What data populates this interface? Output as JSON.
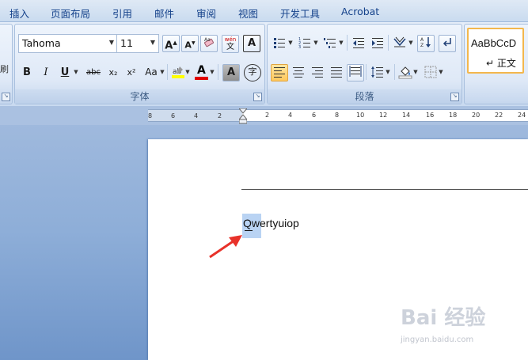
{
  "tabs": [
    "插入",
    "页面布局",
    "引用",
    "邮件",
    "审阅",
    "视图",
    "开发工具",
    "Acrobat"
  ],
  "left_edge_glyph": "刷",
  "font_group": {
    "label": "字体",
    "font_name": "Tahoma",
    "font_size": "11",
    "grow_label": "A",
    "shrink_label": "A",
    "bold": "B",
    "italic": "I",
    "underline": "U",
    "strikethrough": "abc",
    "subscript": "x₂",
    "superscript": "x²",
    "change_case": "Aa",
    "font_color_letter": "A",
    "shading_letter": "A",
    "phonetic_label": "wén",
    "enclose_char": "字",
    "highlight_color": "#ffff00",
    "font_color": "#e00000"
  },
  "paragraph_group": {
    "label": "段落"
  },
  "styles": {
    "preview": "AaBbCcD",
    "name": "↵ 正文"
  },
  "ruler": {
    "labels": [
      "8",
      "6",
      "4",
      "2",
      "2",
      "4",
      "6",
      "8",
      "10",
      "12",
      "14",
      "16",
      "18",
      "20",
      "22",
      "24"
    ]
  },
  "document": {
    "text": "Qwertyuiop"
  },
  "watermark": {
    "main": "Bai 经验",
    "sub": "jingyan.baidu.com"
  },
  "colors": {
    "accent": "#15428b",
    "selection": "#b9d3f3",
    "arrow": "#e8322a"
  }
}
